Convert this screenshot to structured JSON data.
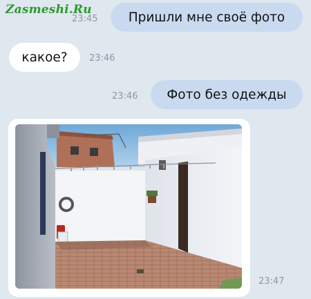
{
  "watermark": "Zasmeshi.Ru",
  "messages": [
    {
      "text": "Пришли мне своё фото",
      "time": "23:45",
      "direction": "outgoing"
    },
    {
      "text": "какое?",
      "time": "23:46",
      "direction": "incoming"
    },
    {
      "text": "Фото без одежды",
      "time": "23:46",
      "direction": "outgoing"
    },
    {
      "image": "courtyard-photo",
      "time": "23:47",
      "direction": "incoming"
    }
  ],
  "colors": {
    "background": "#dfe7ef",
    "outgoing_bubble": "#c9daf0",
    "incoming_bubble": "#ffffff",
    "timestamp": "#8f97a1",
    "watermark": "#2c9a2e"
  }
}
